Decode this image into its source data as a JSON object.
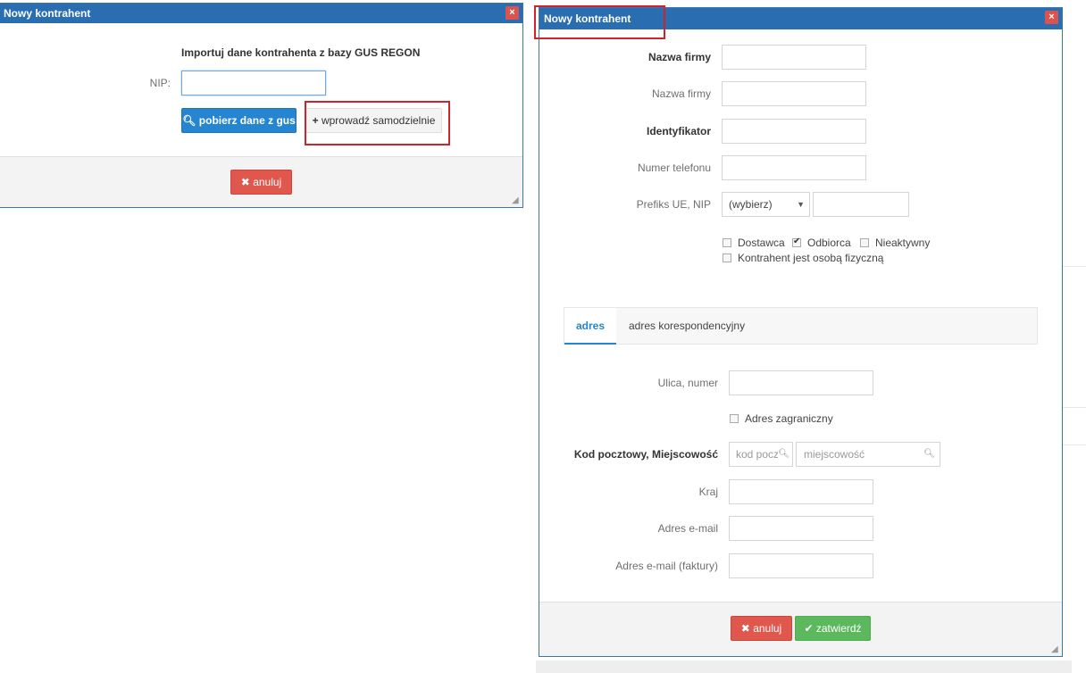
{
  "dialog1": {
    "title": "Nowy kontrahent",
    "close": "×",
    "heading": "Importuj dane kontrahenta z bazy GUS REGON",
    "nip_label": "NIP:",
    "nip_value": "",
    "fetch_label": "pobierz dane z gus",
    "manual_label": "wprowadź samodzielnie",
    "cancel_label": "anuluj"
  },
  "dialog2": {
    "title": "Nowy kontrahent",
    "close": "×",
    "fields": {
      "company_name_1": "Nazwa firmy",
      "company_name_2": "Nazwa firmy",
      "identifier": "Identyfikator",
      "phone": "Numer telefonu",
      "eu_prefix_nip": "Prefiks UE, NIP"
    },
    "prefix_select": "(wybierz)",
    "checkboxes": {
      "supplier": "Dostawca",
      "recipient": "Odbiorca",
      "inactive": "Nieaktywny",
      "natural_person": "Kontrahent jest osobą fizyczną"
    },
    "checked": {
      "supplier": false,
      "recipient": true,
      "inactive": false,
      "natural_person": false
    },
    "tabs": [
      "adres",
      "adres korespondencyjny"
    ],
    "active_tab": "adres",
    "address": {
      "street": "Ulica, numer",
      "foreign": "Adres zagraniczny",
      "postal_city": "Kod pocztowy, Miejscowość",
      "postal_placeholder": "kod pocz",
      "city_placeholder": "miejscowość",
      "country": "Kraj",
      "email": "Adres e-mail",
      "email_invoice": "Adres e-mail (faktury)"
    },
    "cancel_label": "anuluj",
    "confirm_label": "zatwierdź"
  },
  "colors": {
    "titlebar": "#2a6db0",
    "primary": "#2685d0",
    "danger": "#e0574e",
    "success": "#5cb85c",
    "highlight": "#d0232a"
  }
}
